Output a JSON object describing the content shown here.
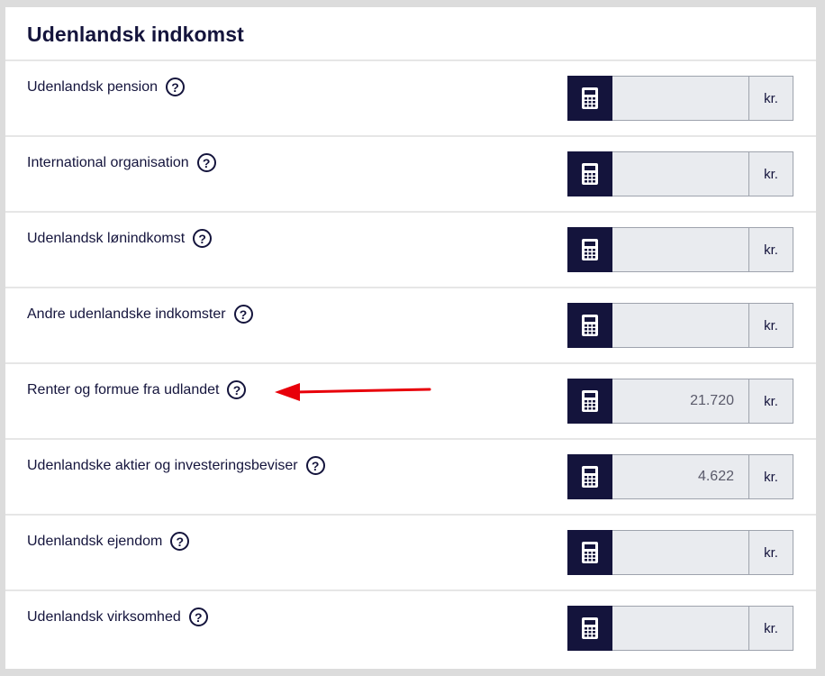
{
  "section": {
    "title": "Udenlandsk indkomst"
  },
  "rows": [
    {
      "label": "Udenlandsk pension",
      "value": "",
      "unit": "kr."
    },
    {
      "label": "International organisation",
      "value": "",
      "unit": "kr."
    },
    {
      "label": "Udenlandsk lønindkomst",
      "value": "",
      "unit": "kr."
    },
    {
      "label": "Andre udenlandske indkomster",
      "value": "",
      "unit": "kr."
    },
    {
      "label": "Renter og formue fra udlandet",
      "value": "21.720",
      "unit": "kr."
    },
    {
      "label": "Udenlandske aktier og investeringsbeviser",
      "value": "4.622",
      "unit": "kr."
    },
    {
      "label": "Udenlandsk ejendom",
      "value": "",
      "unit": "kr."
    },
    {
      "label": "Udenlandsk virksomhed",
      "value": "",
      "unit": "kr."
    }
  ],
  "icons": {
    "help": "?",
    "help_icon_name": "question-circle-icon",
    "calculator_icon_name": "calculator-icon"
  },
  "colors": {
    "navy": "#14143c",
    "input_bg": "#e9ebef",
    "annotation_arrow": "#e8000a"
  }
}
